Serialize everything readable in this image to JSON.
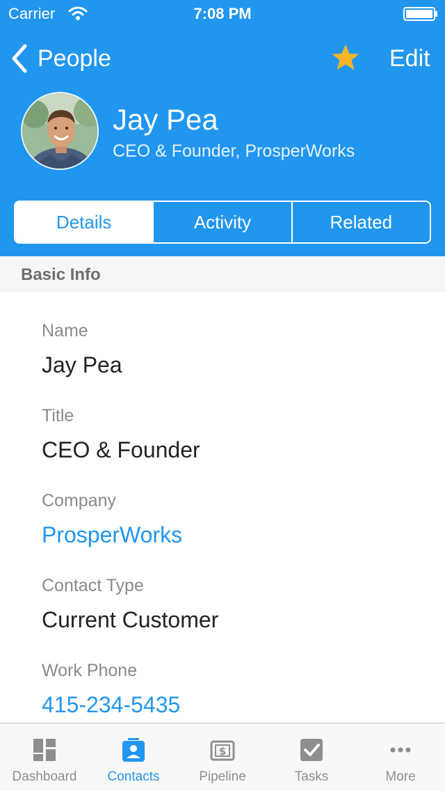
{
  "status_bar": {
    "carrier": "Carrier",
    "time": "7:08 PM"
  },
  "nav": {
    "back_label": "People",
    "edit_label": "Edit",
    "star_color": "#f7b528",
    "favorite": true
  },
  "contact": {
    "name": "Jay Pea",
    "subtitle": "CEO & Founder, ProsperWorks"
  },
  "segments": [
    {
      "label": "Details",
      "active": true
    },
    {
      "label": "Activity",
      "active": false
    },
    {
      "label": "Related",
      "active": false
    }
  ],
  "section": {
    "title": "Basic Info"
  },
  "fields": [
    {
      "label": "Name",
      "value": "Jay Pea"
    },
    {
      "label": "Title",
      "value": "CEO & Founder"
    },
    {
      "label": "Company",
      "value": "ProsperWorks"
    },
    {
      "label": "Contact Type",
      "value": "Current Customer"
    },
    {
      "label": "Work Phone",
      "value": "415-234-5435"
    }
  ],
  "tabs": [
    {
      "label": "Dashboard",
      "icon": "dashboard-icon"
    },
    {
      "label": "Contacts",
      "icon": "contacts-icon",
      "active": true
    },
    {
      "label": "Pipeline",
      "icon": "pipeline-icon"
    },
    {
      "label": "Tasks",
      "icon": "tasks-icon"
    },
    {
      "label": "More",
      "icon": "more-icon"
    }
  ],
  "colors": {
    "brand": "#2196ef",
    "tab_inactive": "#8e8e8e",
    "accent_star": "#f7b528"
  }
}
